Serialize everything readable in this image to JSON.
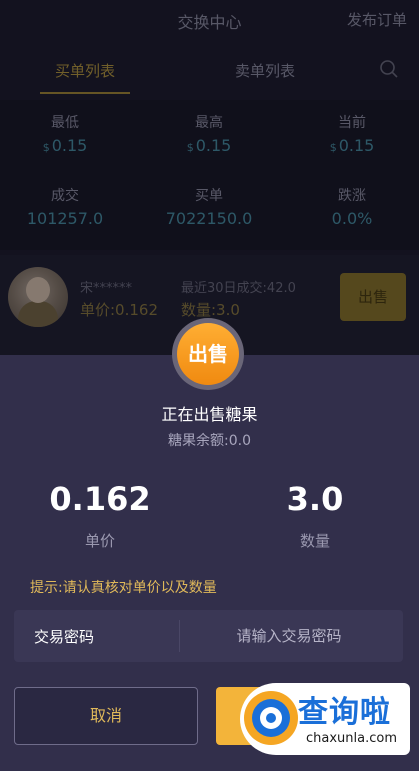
{
  "header": {
    "title": "交换中心",
    "publish": "发布订单"
  },
  "tabs": {
    "buy": "买单列表",
    "sell": "卖单列表",
    "search_icon": "search-icon"
  },
  "stats": {
    "currency": "$",
    "low": {
      "label": "最低",
      "value": "0.15"
    },
    "high": {
      "label": "最高",
      "value": "0.15"
    },
    "current": {
      "label": "当前",
      "value": "0.15"
    },
    "volume": {
      "label": "成交",
      "value": "101257.0"
    },
    "buy_orders": {
      "label": "买单",
      "value": "7022150.0"
    },
    "change": {
      "label": "跌涨",
      "value": "0.0%"
    }
  },
  "order": {
    "user": "宋******",
    "unit_price": "单价:0.162",
    "recent": "最近30日成交:42.0",
    "quantity": "数量:3.0",
    "sell_button": "出售"
  },
  "modal": {
    "badge": "出售",
    "title": "正在出售糖果",
    "balance": "糖果余额:0.0",
    "price_value": "0.162",
    "price_label": "单价",
    "qty_value": "3.0",
    "qty_label": "数量",
    "hint": "提示:请认真核对单价以及数量",
    "password_label": "交易密码",
    "password_placeholder": "请输入交易密码",
    "cancel": "取消",
    "confirm": ""
  },
  "watermark": {
    "title": "查询啦",
    "url": "chaxunla.com"
  },
  "colors": {
    "accent_gold": "#e0b95a",
    "value_blue": "#4a8fa6",
    "orange": "#f08a10",
    "sheet_bg": "#322f4b"
  }
}
